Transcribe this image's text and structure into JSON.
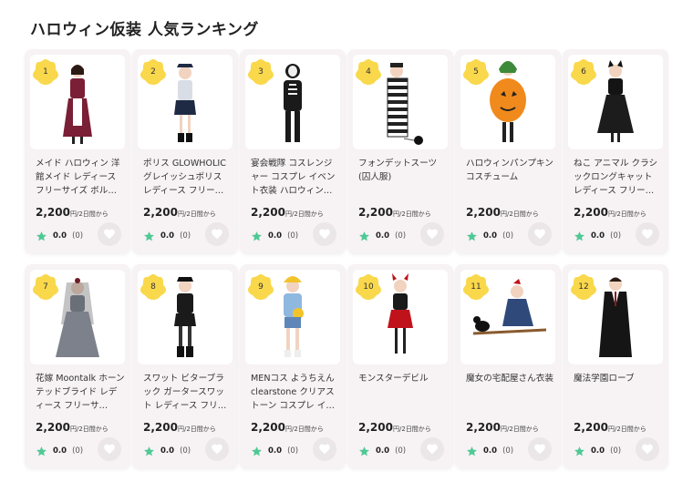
{
  "page": {
    "title": "ハロウィン仮装 人気ランキング"
  },
  "colors": {
    "badge": "#f9d84c",
    "star": "#4fc995",
    "card_bg": "#f7f2f4",
    "fav_bg": "#ebe6e8"
  },
  "products": [
    {
      "rank": "1",
      "name": "メイド ハロウィン 洋館メイド レディース フリーサイズ ボル…",
      "price": "2,200",
      "price_unit": "円/2日間から",
      "rating": "0.0",
      "reviews": "(0)",
      "image": "maid-costume"
    },
    {
      "rank": "2",
      "name": "ポリス GLOWHOLIC グレイッシュポリス レディース フリー…",
      "price": "2,200",
      "price_unit": "円/2日間から",
      "rating": "0.0",
      "reviews": "(0)",
      "image": "police-costume"
    },
    {
      "rank": "3",
      "name": "宴会戦隊 コスレンジャー コスプレ イベント衣装 ハロウィン…",
      "price": "2,200",
      "price_unit": "円/2日間から",
      "rating": "0.0",
      "reviews": "(0)",
      "image": "skeleton-suit"
    },
    {
      "rank": "4",
      "name": "フォンデットスーツ(囚人服)",
      "price": "2,200",
      "price_unit": "円/2日間から",
      "rating": "0.0",
      "reviews": "(0)",
      "image": "prisoner-costume"
    },
    {
      "rank": "5",
      "name": "ハロウィンパンプキンコスチューム",
      "price": "2,200",
      "price_unit": "円/2日間から",
      "rating": "0.0",
      "reviews": "(0)",
      "image": "pumpkin-costume"
    },
    {
      "rank": "6",
      "name": "ねこ アニマル クラシックロングキャット レディース フリー…",
      "price": "2,200",
      "price_unit": "円/2日間から",
      "rating": "0.0",
      "reviews": "(0)",
      "image": "cat-dress"
    },
    {
      "rank": "7",
      "name": "花嫁 Moontalk ホーンテッドブライド レディース フリーサ…",
      "price": "2,200",
      "price_unit": "円/2日間から",
      "rating": "0.0",
      "reviews": "(0)",
      "image": "haunted-bride"
    },
    {
      "rank": "8",
      "name": "スワット ビターブラック ガータースワット レディース フリ…",
      "price": "2,200",
      "price_unit": "円/2日間から",
      "rating": "0.0",
      "reviews": "(0)",
      "image": "swat-costume"
    },
    {
      "rank": "9",
      "name": "MENコス ようちえん clearstone クリアストーン コスプレ イ…",
      "price": "2,200",
      "price_unit": "円/2日間から",
      "rating": "0.0",
      "reviews": "(0)",
      "image": "kindergarten-costume"
    },
    {
      "rank": "10",
      "name": "モンスターデビル",
      "price": "2,200",
      "price_unit": "円/2日間から",
      "rating": "0.0",
      "reviews": "(0)",
      "image": "devil-costume"
    },
    {
      "rank": "11",
      "name": "魔女の宅配屋さん衣装",
      "price": "2,200",
      "price_unit": "円/2日間から",
      "rating": "0.0",
      "reviews": "(0)",
      "image": "witch-delivery"
    },
    {
      "rank": "12",
      "name": "魔法学園ローブ",
      "price": "2,200",
      "price_unit": "円/2日間から",
      "rating": "0.0",
      "reviews": "(0)",
      "image": "magic-robe"
    }
  ]
}
